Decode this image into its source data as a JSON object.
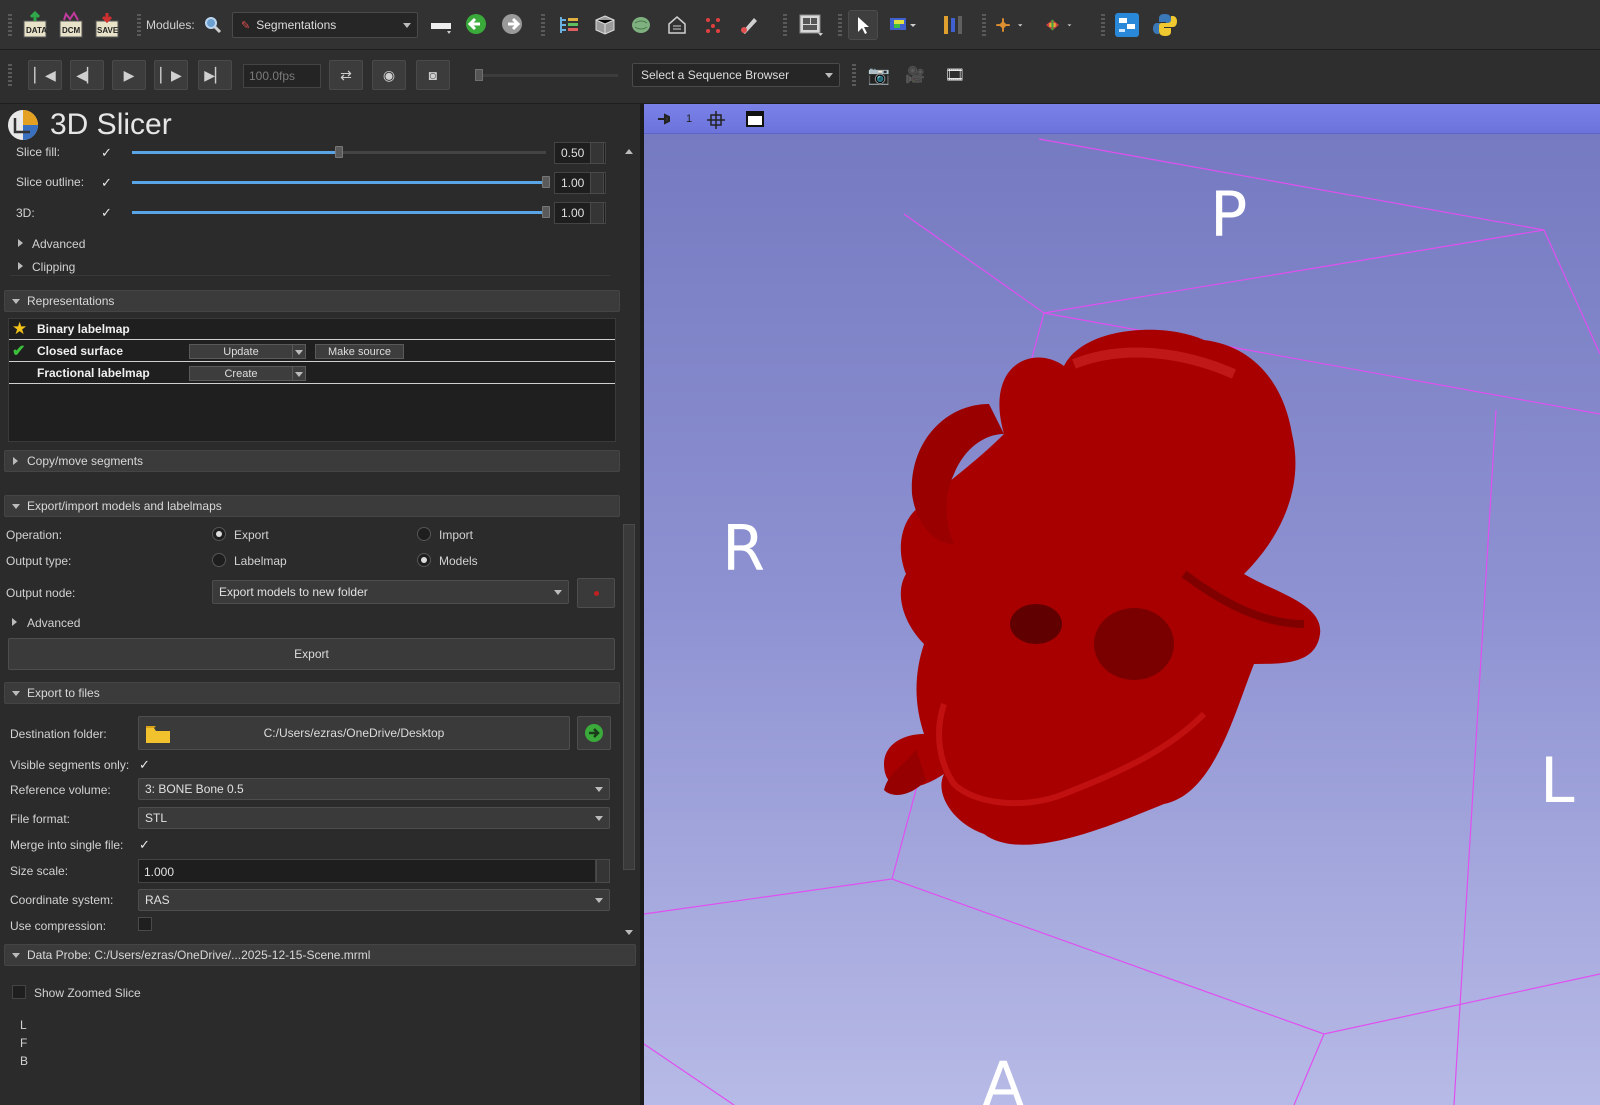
{
  "toolbar": {
    "data_label": "DATA",
    "dcm_label": "DCM",
    "save_label": "SAVE",
    "modules_label": "Modules:",
    "module_selected": "Segmentations"
  },
  "sequence": {
    "fps": "100.0fps",
    "browser_placeholder": "Select a Sequence Browser"
  },
  "app": {
    "title": "3D Slicer"
  },
  "display": {
    "slice_fill": {
      "label": "Slice fill:",
      "checked": true,
      "value": "0.50",
      "level": 0.5
    },
    "slice_outline": {
      "label": "Slice outline:",
      "checked": true,
      "value": "1.00",
      "level": 1.0
    },
    "three_d": {
      "label": "3D:",
      "checked": true,
      "value": "1.00",
      "level": 1.0
    },
    "advanced": "Advanced",
    "clipping": "Clipping"
  },
  "representations": {
    "header": "Representations",
    "rows": [
      {
        "name": "Binary labelmap",
        "status": "source"
      },
      {
        "name": "Closed surface",
        "status": "present",
        "action": "Update",
        "action2": "Make source"
      },
      {
        "name": "Fractional labelmap",
        "status": "none",
        "action": "Create"
      }
    ]
  },
  "copy_move": {
    "header": "Copy/move segments"
  },
  "export_import": {
    "header": "Export/import models and labelmaps",
    "operation_label": "Operation:",
    "export": "Export",
    "import": "Import",
    "output_type_label": "Output type:",
    "labelmap": "Labelmap",
    "models": "Models",
    "output_node_label": "Output node:",
    "output_node_value": "Export models to new folder",
    "advanced": "Advanced",
    "export_button": "Export"
  },
  "export_files": {
    "header": "Export to files",
    "destination_label": "Destination folder:",
    "destination_value": "C:/Users/ezras/OneDrive/Desktop",
    "visible_only_label": "Visible segments only:",
    "reference_label": "Reference volume:",
    "reference_value": "3: BONE Bone 0.5",
    "format_label": "File format:",
    "format_value": "STL",
    "merge_label": "Merge into single file:",
    "scale_label": "Size scale:",
    "scale_value": "1.000",
    "coord_label": "Coordinate system:",
    "coord_value": "RAS",
    "compression_label": "Use compression:"
  },
  "data_probe": {
    "header": "Data Probe: C:/Users/ezras/OneDrive/...2025-12-15-Scene.mrml",
    "show_zoomed": "Show Zoomed Slice",
    "l": "L",
    "f": "F",
    "b": "B"
  },
  "view3d": {
    "view_number": "1",
    "labels": {
      "p": "P",
      "r": "R",
      "l": "L",
      "a": "A"
    },
    "background_top": "#7479c0",
    "background_bottom": "#b7bae6",
    "model_color": "#a80000",
    "box_color": "#e04ff0"
  }
}
